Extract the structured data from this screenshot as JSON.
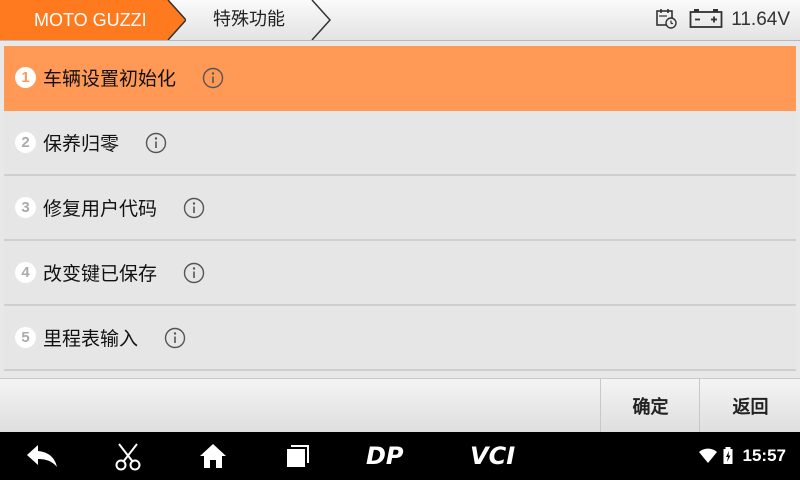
{
  "header": {
    "breadcrumb": [
      "MOTO GUZZI",
      "特殊功能"
    ],
    "voltage": "11.64V",
    "accent_color": "#ff7a1f"
  },
  "menu": {
    "selected_index": 0,
    "items": [
      {
        "num": "1",
        "label": "车辆设置初始化",
        "icon": "info-icon"
      },
      {
        "num": "2",
        "label": "保养归零",
        "icon": "info-icon"
      },
      {
        "num": "3",
        "label": "修复用户代码",
        "icon": "info-icon"
      },
      {
        "num": "4",
        "label": "改变键已保存",
        "icon": "info-icon"
      },
      {
        "num": "5",
        "label": "里程表输入",
        "icon": "info-icon"
      }
    ],
    "selected_color": "#ff9955"
  },
  "actions": {
    "confirm_label": "确定",
    "back_label": "返回"
  },
  "navbar": {
    "icons": [
      "back-icon",
      "scissors-icon",
      "home-icon",
      "recent-apps-icon",
      "dp-logo-icon",
      "vci-logo-icon",
      "wifi-icon",
      "battery-icon"
    ],
    "dp_text": "DP",
    "vci_text": "VCI",
    "time": "15:57"
  }
}
